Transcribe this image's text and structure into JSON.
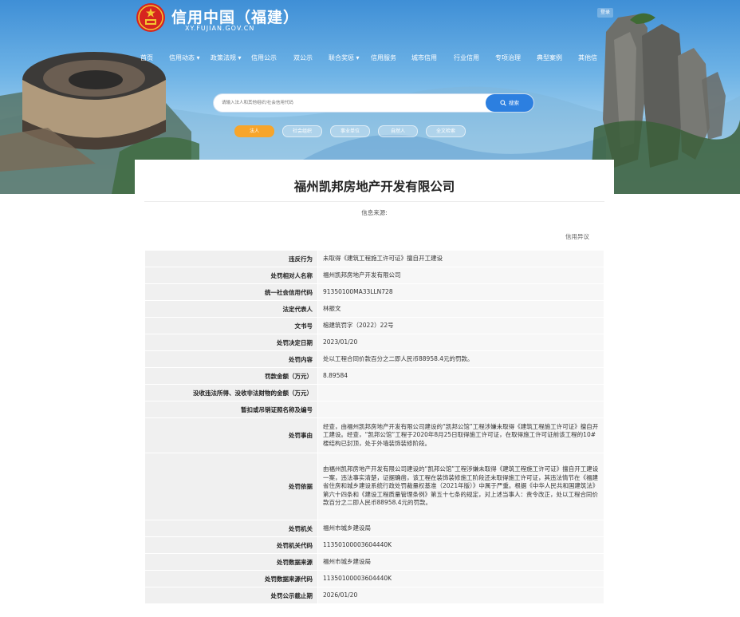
{
  "site": {
    "title": "信用中国（福建）",
    "domain": "XY.FUJIAN.GOV.CN",
    "login": "登录"
  },
  "nav": {
    "items": [
      {
        "label": "首页"
      },
      {
        "label": "信用动态 ▾"
      },
      {
        "label": "政策法规 ▾"
      },
      {
        "label": "信用公示"
      },
      {
        "label": "双公示"
      },
      {
        "label": "联合奖惩 ▾"
      },
      {
        "label": "信用服务"
      },
      {
        "label": "城市信用"
      },
      {
        "label": "行业信用"
      },
      {
        "label": "专项治理"
      },
      {
        "label": "典型案例"
      },
      {
        "label": "其他信"
      }
    ]
  },
  "search": {
    "placeholder": "请输入法人和其他组织/社会信用代码",
    "button": "搜索"
  },
  "categories": [
    {
      "label": "法人",
      "active": true
    },
    {
      "label": "社会组织",
      "active": false
    },
    {
      "label": "事业单位",
      "active": false
    },
    {
      "label": "自然人",
      "active": false
    },
    {
      "label": "全文检索",
      "active": false
    }
  ],
  "record": {
    "company_title": "福州凯邦房地产开发有限公司",
    "info_source": "信息来源:",
    "objection_link": "信用异议",
    "fields": [
      {
        "label": "违反行为",
        "value": "未取得《建筑工程施工许可证》擅自开工建设"
      },
      {
        "label": "处罚相对人名称",
        "value": "福州凯邦房地产开发有限公司"
      },
      {
        "label": "统一社会信用代码",
        "value": "91350100MA33LLN728"
      },
      {
        "label": "法定代表人",
        "value": "林振文"
      },
      {
        "label": "文书号",
        "value": "榕建筑罚字（2022）22号"
      },
      {
        "label": "处罚决定日期",
        "value": "2023/01/20"
      },
      {
        "label": "处罚内容",
        "value": "处以工程合同价款百分之二即人民币88958.4元的罚款。"
      },
      {
        "label": "罚款金额（万元）",
        "value": "8.89584"
      },
      {
        "label": "没收违法所得、没收非法财物的金额（万元）",
        "value": ""
      },
      {
        "label": "暂扣或吊销证照名称及编号",
        "value": ""
      },
      {
        "label": "处罚事由",
        "value": "经查，由福州凯邦房地产开发有限公司建设的“凯邦公馆”工程涉嫌未取得《建筑工程施工许可证》擅自开工建设。经查，“凯邦公馆”工程于2020年8月25日取得施工许可证，在取得施工许可证前该工程的10#楼结构已封顶，处于外墙装饰装修阶段。"
      },
      {
        "label": "处罚依据",
        "value": "由福州凯邦房地产开发有限公司建设的“凯邦公馆”工程涉嫌未取得《建筑工程施工许可证》擅自开工建设一案，违法事实清楚，证据确凿，该工程在装饰装修施工阶段还未取得施工许可证，其违法情节在《福建省住房和城乡建设系统行政处罚裁量权基准（2021年版）》中属于严重。根据《中华人民共和国建筑法》第六十四条和《建设工程质量管理条例》第五十七条的规定，对上述当事人：责令改正，处以工程合同价款百分之二即人民币88958.4元的罚款。"
      },
      {
        "label": "处罚机关",
        "value": "福州市城乡建设局"
      },
      {
        "label": "处罚机关代码",
        "value": "11350100003604440K"
      },
      {
        "label": "处罚数据来源",
        "value": "福州市城乡建设局"
      },
      {
        "label": "处罚数据来源代码",
        "value": "11350100003604440K"
      },
      {
        "label": "处罚公示截止期",
        "value": "2026/01/20"
      }
    ]
  },
  "colors": {
    "search_button": "#2c7fe0",
    "active_category": "#f7a52b",
    "label_cell": "#f0f0f0",
    "value_cell": "#f7f7f7"
  }
}
